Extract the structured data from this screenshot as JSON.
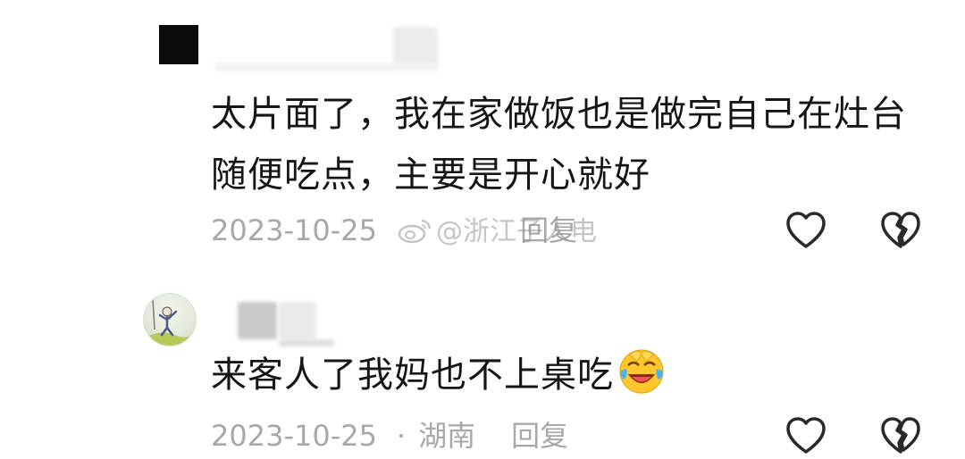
{
  "comments": [
    {
      "text": "太片面了，我在家做饭也是做完自己在灶台随便吃点，主要是开心就好",
      "date": "2023-10-25",
      "reply_label": "回复"
    },
    {
      "text": "来客人了我妈也不上桌吃",
      "emoji": "laughing-crying-emoji",
      "date": "2023-10-25",
      "separator": "·",
      "location": "湖南",
      "reply_label": "回复"
    }
  ],
  "watermark": {
    "text": "@浙江子人电"
  },
  "icons": {
    "like": "heart-outline-icon",
    "dislike": "broken-heart-outline-icon"
  },
  "colors": {
    "text": "#161616",
    "meta": "#a8a8a8",
    "icon_stroke": "#2a2a2a"
  }
}
